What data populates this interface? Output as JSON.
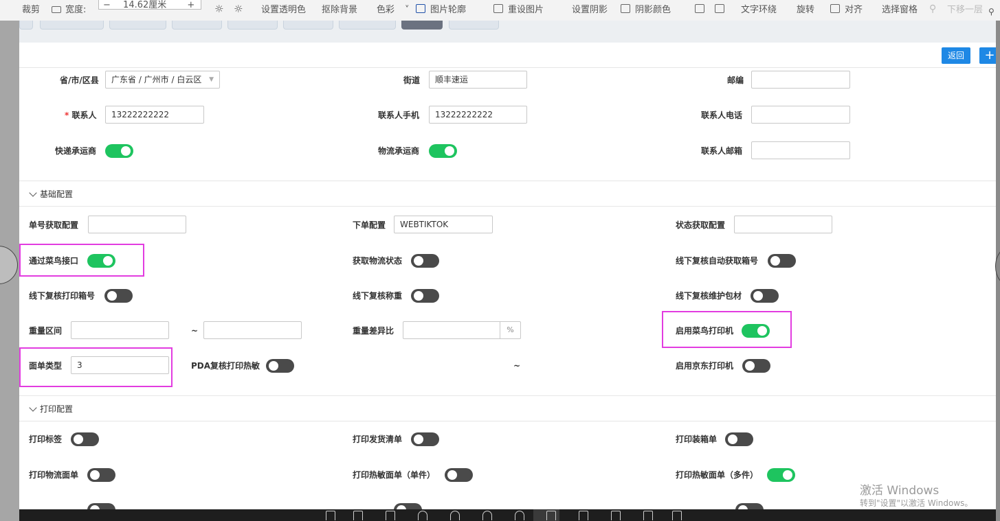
{
  "ribbon": {
    "crop": "裁剪",
    "width_label": "宽度:",
    "width_value": "14.62厘米",
    "set_transparent": "设置透明色",
    "remove_bg": "抠除背景",
    "color": "色彩",
    "picture_outline": "图片轮廓",
    "reset_picture": "重设图片",
    "set_shadow": "设置阴影",
    "shadow_color": "阴影颜色",
    "text_wrap": "文字环绕",
    "rotate": "旋转",
    "align": "对齐",
    "selection_pane": "选择窗格",
    "move_down": "下移一层"
  },
  "actions": {
    "back": "返回",
    "add": "+"
  },
  "contact": {
    "region_label": "省/市/区县",
    "region_value": "广东省 / 广州市 / 白云区",
    "street_label": "街道",
    "street_value": "顺丰速运",
    "postcode_label": "邮编",
    "postcode_value": "",
    "required_mark": "*",
    "contact_label": "联系人",
    "contact_value": "13222222222",
    "mobile_label": "联系人手机",
    "mobile_value": "13222222222",
    "phone_label": "联系人电话",
    "phone_value": "",
    "express_label": "快递承运商",
    "express_on": true,
    "logistics_label": "物流承运商",
    "logistics_on": true,
    "email_label": "联系人邮箱",
    "email_value": ""
  },
  "basic": {
    "title": "基础配置",
    "tracking_label": "单号获取配置",
    "tracking_value": "",
    "order_label": "下单配置",
    "order_value": "WEBTIKTOK",
    "status_label": "状态获取配置",
    "status_value": "",
    "cainiao_label": "通过菜鸟接口",
    "cainiao_on": true,
    "fetch_status_label": "获取物流状态",
    "fetch_status_on": false,
    "auto_box_label": "线下复核自动获取箱号",
    "auto_box_on": false,
    "print_box_label": "线下复核打印箱号",
    "print_box_on": false,
    "weigh_label": "线下复核称重",
    "weigh_on": false,
    "packing_label": "线下复核维护包材",
    "packing_on": false,
    "weight_range_label": "重量区间",
    "weight_min": "",
    "range_sep": "~",
    "weight_max": "",
    "weight_diff_label": "重量差异比",
    "weight_diff_value": "",
    "percent": "%",
    "cainiao_printer_label": "启用菜鸟打印机",
    "cainiao_printer_on": true,
    "waybill_type_label": "面单类型",
    "waybill_type_value": "3",
    "pda_label": "PDA复核打印热敏",
    "pda_on": false,
    "tilde2": "~",
    "jd_printer_label": "启用京东打印机",
    "jd_printer_on": false
  },
  "print": {
    "title": "打印配置",
    "label_label": "打印标签",
    "label_on": false,
    "delivery_list_label": "打印发货清单",
    "delivery_list_on": false,
    "packing_list_label": "打印装箱单",
    "packing_list_on": false,
    "logistics_waybill_label": "打印物流面单",
    "logistics_waybill_on": false,
    "thermal_single_label": "打印热敏面单（单件）",
    "thermal_single_on": false,
    "thermal_multi_label": "打印热敏面单（多件）",
    "thermal_multi_on": true
  },
  "watermark": {
    "line1": "激活 Windows",
    "line2": "转到\"设置\"以激活 Windows。"
  },
  "colors": {
    "accent": "#1e88e5",
    "switch_on": "#1ec45f",
    "switch_off": "#4a4a4a",
    "highlight": "#e23ce0"
  }
}
